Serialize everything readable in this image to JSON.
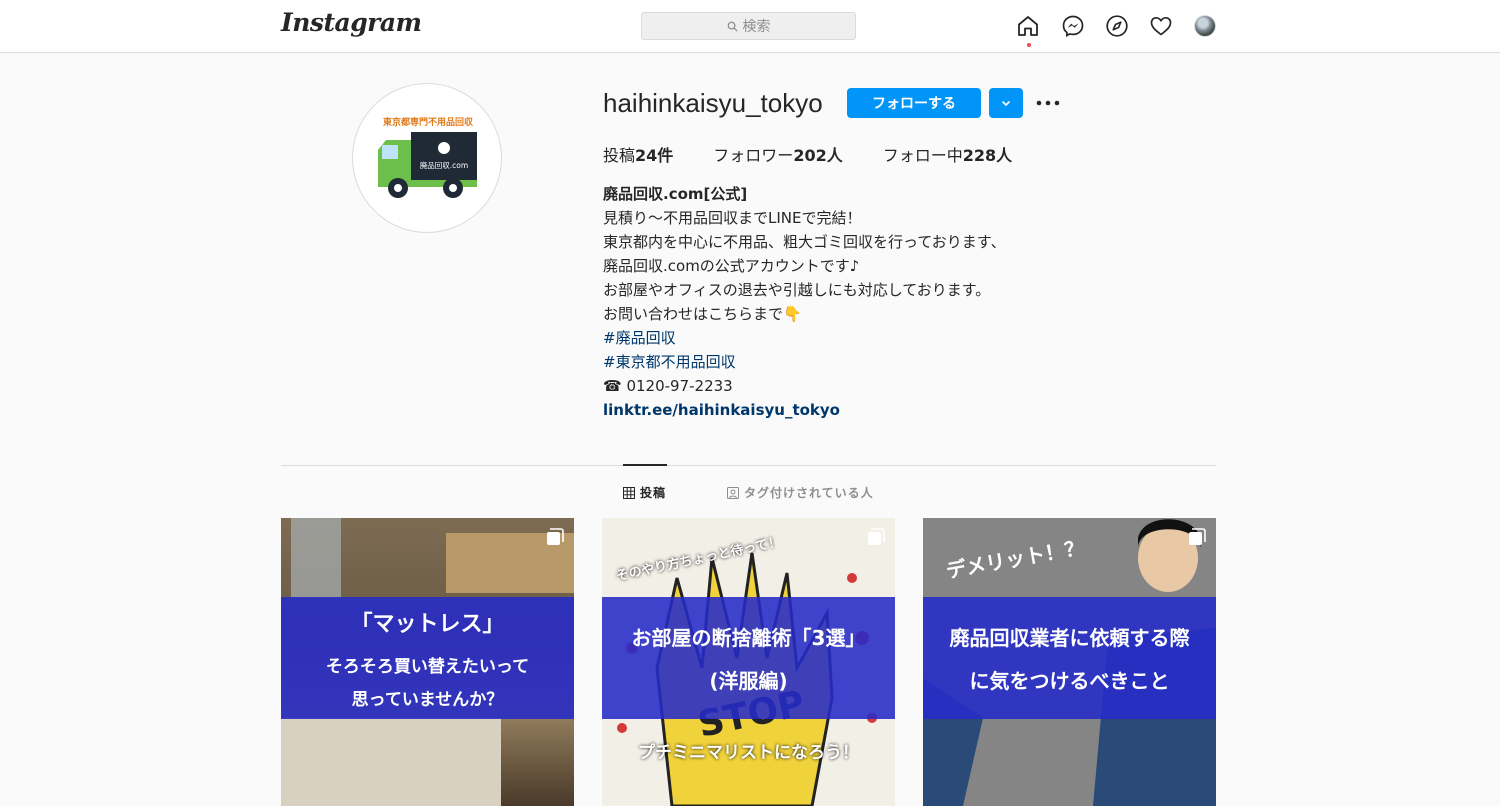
{
  "nav": {
    "logo": "Instagram",
    "search_placeholder": "検索",
    "icons": [
      "home-icon",
      "messenger-icon",
      "explore-icon",
      "heart-icon",
      "profile-avatar"
    ]
  },
  "profile": {
    "username": "haihinkaisyu_tokyo",
    "follow_label": "フォローする",
    "pic_caption": "東京都専門不用品回収",
    "pic_truck_label": "廃品回収.com",
    "stats": {
      "posts_label": "投稿",
      "posts_count": "24件",
      "followers_label": "フォロワー",
      "followers_count": "202人",
      "following_label": "フォロー中",
      "following_count": "228人"
    },
    "bio": {
      "name": "廃品回収.com[公式]",
      "line1": "見積り～不用品回収までLINEで完結！",
      "line2": "東京都内を中心に不用品、粗大ゴミ回収を行っております、",
      "line3": "廃品回収.comの公式アカウントです♪",
      "line4": "お部屋やオフィスの退去や引越しにも対応しております。",
      "line5": "お問い合わせはこちらまで👇",
      "tag1": "#廃品回収",
      "tag2": "#東京都不用品回収",
      "phone": "☎ 0120-97-2233",
      "link": "linktr.ee/haihinkaisyu_tokyo"
    }
  },
  "tabs": {
    "posts": "投稿",
    "tagged": "タグ付けされている人"
  },
  "posts": [
    {
      "title": "「マットレス」",
      "line2": "そろそろ買い替えたいって",
      "line3": "思っていませんか？"
    },
    {
      "top": "そのやり方ちょっと待って！",
      "title": "お部屋の断捨離術「3選」",
      "line2": "(洋服編)",
      "bottom": "プチミニマリストになろう！",
      "stop": "STOP"
    },
    {
      "top": "デメリット！？",
      "title": "廃品回収業者に依頼する際",
      "line2": "に気をつけるべきこと"
    }
  ],
  "colors": {
    "primary_blue": "#0095f6",
    "link_blue": "#00376b",
    "band_blue": "#262bc8",
    "notification_red": "#ed4956"
  }
}
